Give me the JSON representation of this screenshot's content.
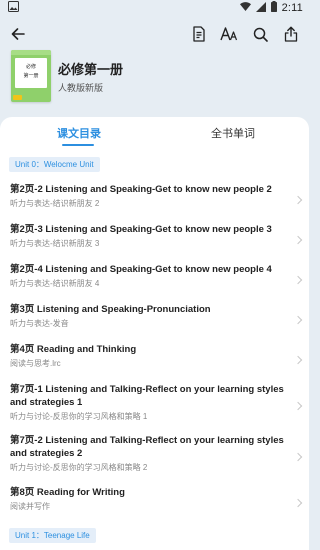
{
  "status_bar": {
    "time": "2:11",
    "icons": [
      "image-notification-icon",
      "wifi-icon",
      "signal-icon",
      "battery-icon"
    ]
  },
  "toolbar": {
    "icons": [
      "back-arrow-icon",
      "notes-icon",
      "font-size-icon",
      "search-icon",
      "share-icon"
    ]
  },
  "book": {
    "title": "必修第一册",
    "edition": "人教版新版",
    "cover": {
      "line1": "必修",
      "line2": "第一册",
      "colors": {
        "cover": "#8fd06b",
        "tag": "#f0c419"
      }
    }
  },
  "tabs": [
    {
      "label": "课文目录",
      "active": true
    },
    {
      "label": "全书单词",
      "active": false
    }
  ],
  "units": [
    {
      "label": "Unit 0：Welocme Unit"
    },
    {
      "label": "Unit 1：Teenage Life"
    }
  ],
  "lessons": [
    {
      "title": "第2页-2 Listening and Speaking-Get to know new people 2",
      "subtitle": "听力与表达-结识新朋友 2"
    },
    {
      "title": "第2页-3 Listening and Speaking-Get to know new people 3",
      "subtitle": "听力与表达-结识新朋友 3"
    },
    {
      "title": "第2页-4 Listening and Speaking-Get to know new people 4",
      "subtitle": "听力与表达-结识新朋友 4"
    },
    {
      "title": "第3页 Listening and Speaking-Pronunciation",
      "subtitle": "听力与表达-发音"
    },
    {
      "title": "第4页 Reading and Thinking",
      "subtitle": "阅读与思考.lrc"
    },
    {
      "title": "第7页-1 Listening and Talking-Reflect on your learning styles and strategies 1",
      "subtitle": "听力与讨论-反思你的学习风格和策略 1"
    },
    {
      "title": "第7页-2 Listening and Talking-Reflect on your learning styles and strategies 2",
      "subtitle": "听力与讨论-反思你的学习风格和策略 2"
    },
    {
      "title": "第8页 Reading for Writing",
      "subtitle": "阅读并写作"
    }
  ],
  "colors": {
    "accent": "#2c8fe0",
    "header_bg": "#e6edf3",
    "unit_label_bg": "#e4eef9"
  }
}
